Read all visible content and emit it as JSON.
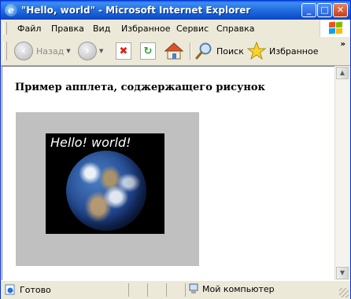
{
  "window": {
    "title": "\"Hello, world\" - Microsoft Internet Explorer",
    "minimize_glyph": "_",
    "maximize_glyph": "□",
    "close_glyph": "✕"
  },
  "menubar": {
    "items": [
      {
        "label": "Файл"
      },
      {
        "label": "Правка"
      },
      {
        "label": "Вид"
      },
      {
        "label": "Избранное"
      },
      {
        "label": "Сервис"
      },
      {
        "label": "Справка"
      }
    ]
  },
  "toolbar": {
    "back_label": "Назад",
    "search_label": "Поиск",
    "favorites_label": "Избранное",
    "more_glyph": "»"
  },
  "content": {
    "heading": "Пример апплета, соджержащего рисунок",
    "applet_text": "Hello! world!"
  },
  "statusbar": {
    "status_text": "Готово",
    "zone_text": "Мой компьютер"
  },
  "colors": {
    "titlebar": "#1356d1",
    "applet_bg": "#c0c0c0",
    "content_bg": "#ffffff"
  }
}
